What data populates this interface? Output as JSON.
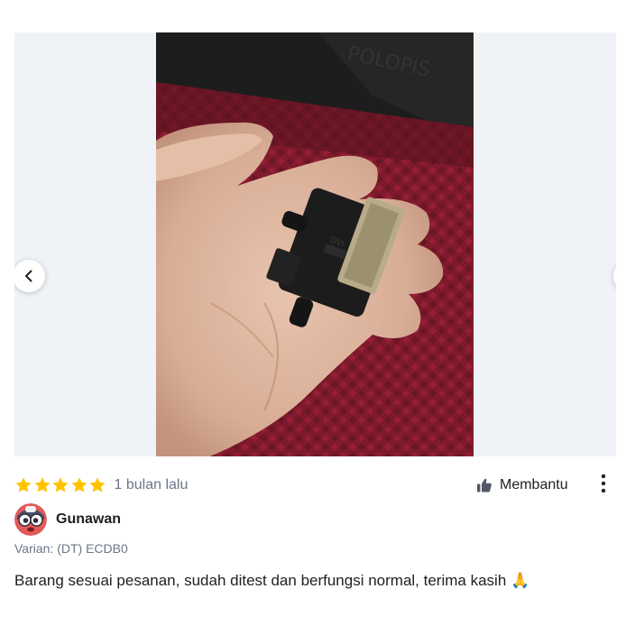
{
  "gallery": {
    "prev_icon": "chevron-left-icon",
    "next_icon": "chevron-right-icon",
    "photo_subject": "DVI adapter held in hand"
  },
  "review": {
    "rating": 5,
    "rating_max": 5,
    "star_color": "#ffc400",
    "time_ago": "1 bulan lalu",
    "helpful_label": "Membantu",
    "helpful_icon": "thumbs-up-icon",
    "more_icon": "more-vertical-icon",
    "reviewer_name": "Gunawan",
    "variant": "Varian: (DT) ECDB0",
    "text": "Barang sesuai pesanan, sudah ditest dan berfungsi normal, terima kasih",
    "emoji": "🙏"
  }
}
